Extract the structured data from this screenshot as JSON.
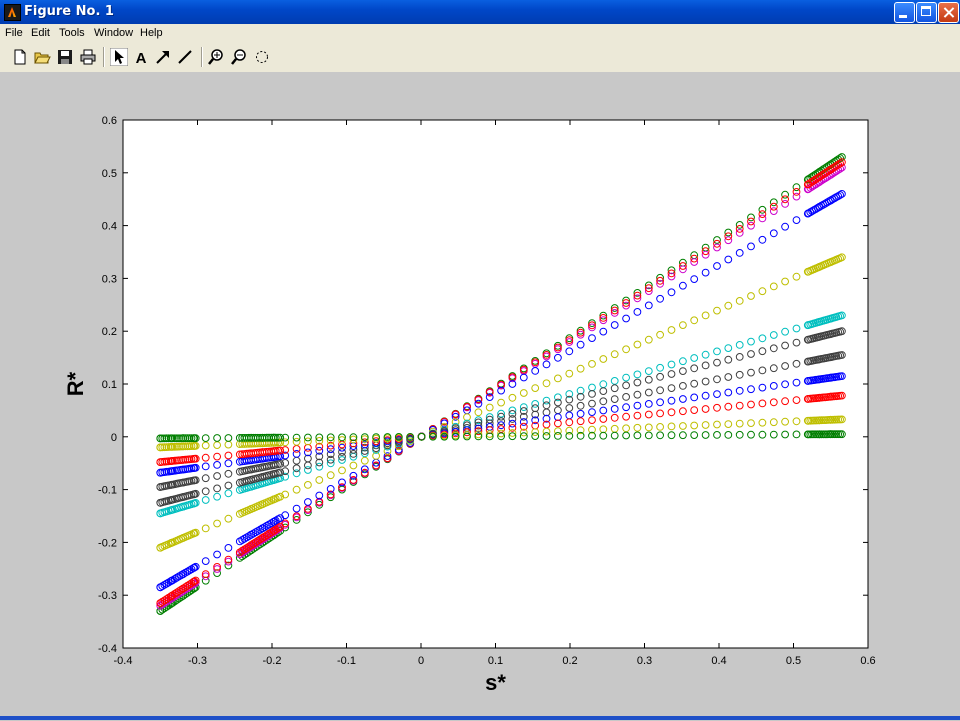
{
  "window": {
    "title": "Figure No. 1"
  },
  "menu": [
    "File",
    "Edit",
    "Tools",
    "Window",
    "Help"
  ],
  "toolbar": {
    "icons": [
      "new-file-icon",
      "open-folder-icon",
      "save-icon",
      "print-icon",
      "pointer-icon",
      "text-icon",
      "arrow-icon",
      "line-icon",
      "zoom-in-icon",
      "zoom-out-icon",
      "rotate-icon"
    ],
    "text_tool_label": "A"
  },
  "chart_data": {
    "type": "scatter",
    "title": "",
    "xlabel": "s*",
    "ylabel": "R*",
    "xlim": [
      -0.4,
      0.6
    ],
    "ylim": [
      -0.4,
      0.6
    ],
    "xticks": [
      "-0.4",
      "-0.3",
      "-0.2",
      "-0.1",
      "0",
      "0.1",
      "0.2",
      "0.3",
      "0.4",
      "0.5",
      "0.6"
    ],
    "yticks": [
      "-0.4",
      "-0.3",
      "-0.2",
      "-0.1",
      "0",
      "0.1",
      "0.2",
      "0.3",
      "0.4",
      "0.5",
      "0.6"
    ],
    "grid": false,
    "marker": "open-circle",
    "x_range_of_points": [
      -0.35,
      0.565
    ],
    "series": [
      {
        "color": "#007f00",
        "y_at_xmin": -0.33,
        "y_at_xmax": 0.53
      },
      {
        "color": "#cc00cc",
        "y_at_xmin": -0.32,
        "y_at_xmax": 0.51
      },
      {
        "color": "#ff0000",
        "y_at_xmin": -0.315,
        "y_at_xmax": 0.52
      },
      {
        "color": "#0000ff",
        "y_at_xmin": -0.285,
        "y_at_xmax": 0.46
      },
      {
        "color": "#bfbf00",
        "y_at_xmin": -0.21,
        "y_at_xmax": 0.34
      },
      {
        "color": "#00bfbf",
        "y_at_xmin": -0.145,
        "y_at_xmax": 0.23
      },
      {
        "color": "#404040",
        "y_at_xmin": -0.125,
        "y_at_xmax": 0.2
      },
      {
        "color": "#404040",
        "y_at_xmin": -0.095,
        "y_at_xmax": 0.155
      },
      {
        "color": "#0000ff",
        "y_at_xmin": -0.068,
        "y_at_xmax": 0.115
      },
      {
        "color": "#ff0000",
        "y_at_xmin": -0.048,
        "y_at_xmax": 0.078
      },
      {
        "color": "#bfbf00",
        "y_at_xmin": -0.02,
        "y_at_xmax": 0.033
      },
      {
        "color": "#007f00",
        "y_at_xmin": -0.003,
        "y_at_xmax": 0.005
      }
    ]
  }
}
